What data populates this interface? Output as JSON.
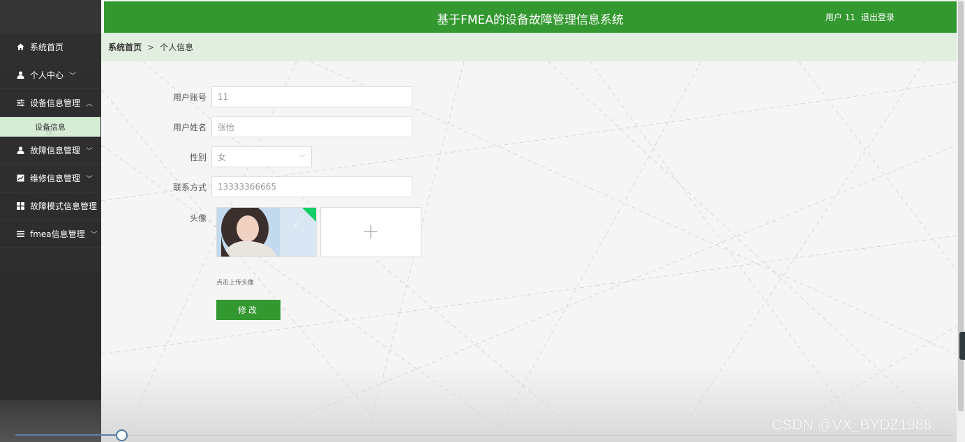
{
  "header": {
    "title": "基于FMEA的设备故障管理信息系统",
    "user_label": "用户 11",
    "logout": "退出登录"
  },
  "sidebar": {
    "items": [
      {
        "label": "系统首页",
        "icon": "home-icon"
      },
      {
        "label": "个人中心",
        "icon": "user-icon",
        "arrow": "down"
      },
      {
        "label": "设备信息管理",
        "icon": "sliders-icon",
        "arrow": "up"
      },
      {
        "label": "故障信息管理",
        "icon": "user-icon",
        "arrow": "down"
      },
      {
        "label": "维修信息管理",
        "icon": "chart-icon",
        "arrow": "down"
      },
      {
        "label": "故障模式信息管理",
        "icon": "grid-icon"
      },
      {
        "label": "fmea信息管理",
        "icon": "list-icon",
        "arrow": "down"
      }
    ],
    "submenu": {
      "label": "设备信息"
    }
  },
  "breadcrumb": {
    "home": "系统首页",
    "separator": ">",
    "current": "个人信息"
  },
  "form": {
    "account_label": "用户账号",
    "account_value": "11",
    "name_label": "用户姓名",
    "name_value": "张怡",
    "gender_label": "性别",
    "gender_value": "女",
    "phone_label": "联系方式",
    "phone_value": "13333366665",
    "avatar_label": "头像",
    "upload_tip": "点击上传头像",
    "submit_label": "修改"
  },
  "watermark": "CSDN @VX_BYDZ1988",
  "colors": {
    "primary": "#33982f",
    "sidebar_bg": "#2f2f2f",
    "breadcrumb_bg": "#e2eedf",
    "submenu_bg": "#d6ecd4"
  }
}
